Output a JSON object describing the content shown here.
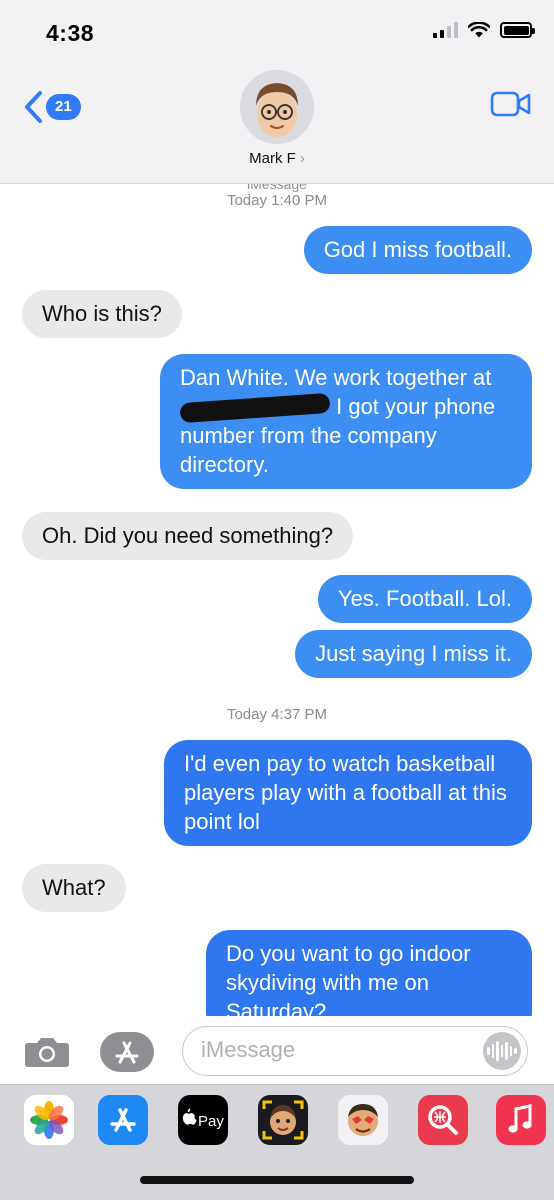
{
  "status_bar": {
    "time": "4:38"
  },
  "header": {
    "back_count": "21",
    "contact_name": "Mark F",
    "chevron": "›",
    "accent": "#2f7cf6"
  },
  "thread": {
    "service_label": "iMessage",
    "timestamps": [
      "Today 1:40 PM",
      "Today 4:37 PM"
    ],
    "messages": [
      {
        "from": "me",
        "text": "God I miss football."
      },
      {
        "from": "them",
        "text": "Who is this?"
      },
      {
        "from": "me",
        "text_before": "Dan White. We work together at ",
        "text_after": " I got your phone number from the company directory."
      },
      {
        "from": "them",
        "text": "Oh. Did you need something?"
      },
      {
        "from": "me",
        "text": "Yes. Football. Lol."
      },
      {
        "from": "me",
        "text": "Just saying I miss it."
      },
      {
        "from": "me",
        "text": "I'd even pay to watch basketball players play with a football at this point lol"
      },
      {
        "from": "them",
        "text": "What?"
      },
      {
        "from": "me",
        "text": "Do you want to go indoor skydiving with me on Saturday?"
      }
    ]
  },
  "input": {
    "placeholder": "iMessage"
  },
  "apps": {
    "items": [
      "photos-icon",
      "app-store-icon",
      "apple-pay-icon",
      "memoji-camera-icon",
      "memoji-stickers-icon",
      "search-images-icon",
      "music-icon"
    ],
    "apple_pay_label": "Pay"
  }
}
